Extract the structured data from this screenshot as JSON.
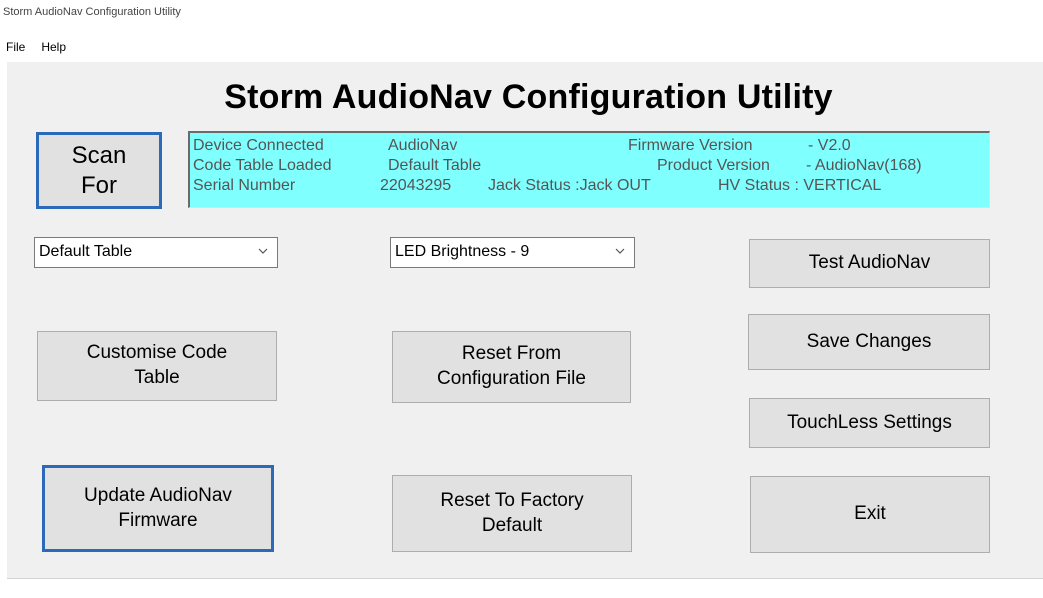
{
  "window": {
    "title": "Storm AudioNav Configuration Utility"
  },
  "menu": {
    "file": "File",
    "help": "Help"
  },
  "app_title": "Storm AudioNav Configuration Utility",
  "scan_button": {
    "line1": "Scan",
    "line2": "For"
  },
  "info": {
    "device_connected_label": "Device Connected",
    "device_connected_value": "AudioNav",
    "firmware_version_label": "Firmware Version",
    "firmware_version_value": "-  V2.0",
    "code_table_label": "Code Table Loaded",
    "code_table_value": "Default Table",
    "product_version_label": "Product Version",
    "product_version_value": "-  AudioNav(168)",
    "serial_number_label": "Serial Number",
    "serial_number_value": "22043295",
    "jack_status": "Jack Status :Jack OUT",
    "hv_status": "HV Status : VERTICAL"
  },
  "selects": {
    "code_table": "Default Table",
    "led_brightness": "LED Brightness - 9"
  },
  "buttons": {
    "test": "Test AudioNav",
    "customise_line1": "Customise Code",
    "customise_line2": "Table",
    "reset_config_line1": "Reset From",
    "reset_config_line2": "Configuration File",
    "save": "Save Changes",
    "touchless": "TouchLess Settings",
    "update_line1": "Update AudioNav",
    "update_line2": "Firmware",
    "reset_factory_line1": "Reset To Factory",
    "reset_factory_line2": "Default",
    "exit": "Exit"
  },
  "colors": {
    "info_background": "#80ffff",
    "focus_border": "#2b6ab8",
    "button_face": "#e1e1e1"
  },
  "icons": {
    "dropdown": "chevron-down-icon"
  }
}
